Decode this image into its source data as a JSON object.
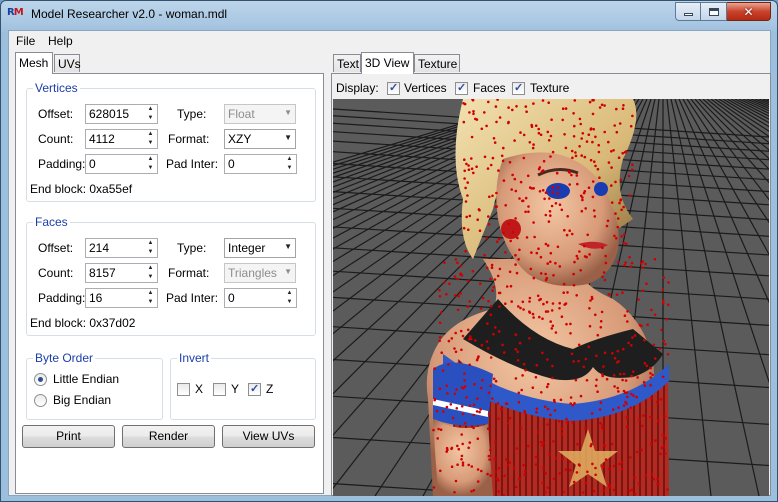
{
  "window": {
    "icon_text_red": "M",
    "icon_text_blue": "R",
    "title": "Model Researcher v2.0 - woman.mdl"
  },
  "menu": [
    "File",
    "Help"
  ],
  "left_tabs": [
    "Mesh",
    "UVs"
  ],
  "vertices": {
    "title": "Vertices",
    "offset_label": "Offset:",
    "offset": "628015",
    "count_label": "Count:",
    "count": "4112",
    "padding_label": "Padding:",
    "padding": "0",
    "type_label": "Type:",
    "type": "Float",
    "format_label": "Format:",
    "format": "XZY",
    "pad_inter_label": "Pad Inter:",
    "pad_inter": "0",
    "end_block": "End block: 0xa55ef"
  },
  "faces": {
    "title": "Faces",
    "offset_label": "Offset:",
    "offset": "214",
    "count_label": "Count:",
    "count": "8157",
    "padding_label": "Padding:",
    "padding": "16",
    "type_label": "Type:",
    "type": "Integer",
    "format_label": "Format:",
    "format": "Triangles",
    "pad_inter_label": "Pad Inter:",
    "pad_inter": "0",
    "end_block": "End block: 0x37d02"
  },
  "byte_order": {
    "title": "Byte Order",
    "options": [
      "Little Endian",
      "Big Endian"
    ],
    "selected": "Little Endian"
  },
  "invert": {
    "title": "Invert",
    "x": {
      "label": "X",
      "checked": false
    },
    "y": {
      "label": "Y",
      "checked": false
    },
    "z": {
      "label": "Z",
      "checked": true
    }
  },
  "buttons": {
    "print": "Print",
    "render": "Render",
    "view_uvs": "View UVs"
  },
  "right_tabs": [
    "Text",
    "3D View",
    "Texture"
  ],
  "display": {
    "label": "Display:",
    "vertices": {
      "label": "Vertices",
      "checked": true
    },
    "faces": {
      "label": "Faces",
      "checked": true
    },
    "texture": {
      "label": "Texture",
      "checked": true
    }
  },
  "colors": {
    "accent_title": "#1c3ea8",
    "viewport_bg": "#5a5a5a",
    "grid": "#1a1a1a",
    "vertex_dots": "#d00000"
  }
}
